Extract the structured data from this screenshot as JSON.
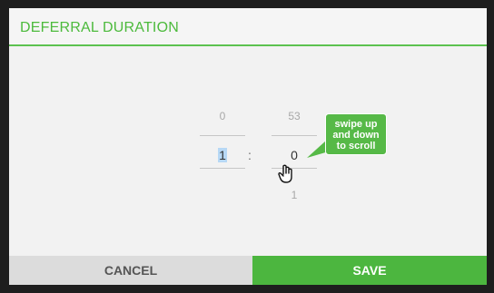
{
  "dialog": {
    "title": "DEFERRAL DURATION"
  },
  "picker": {
    "hours": {
      "previous": "0",
      "current": "1",
      "next": ""
    },
    "separator": ":",
    "minutes": {
      "previous": "53",
      "current": "0",
      "next": "1"
    }
  },
  "tooltip": {
    "text_lines": [
      "swipe up",
      "and down",
      "to scroll"
    ]
  },
  "icons": {
    "gesture": "hand-pointer-icon"
  },
  "buttons": {
    "cancel_label": "CANCEL",
    "save_label": "SAVE"
  },
  "colors": {
    "accent": "#4cb63f",
    "title": "#4cba3c",
    "selection": "#b7d8f5",
    "cancel_bg": "#dcdcdc"
  }
}
